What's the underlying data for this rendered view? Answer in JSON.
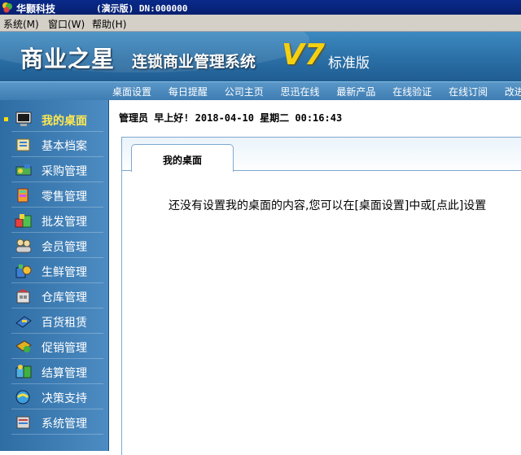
{
  "titlebar": {
    "company": "华颢科技",
    "info": "(演示版) DN:000000"
  },
  "menu": [
    "系统(M)",
    "窗口(W)",
    "帮助(H)"
  ],
  "banner": {
    "brand": "商业之星",
    "subtitle": "连锁商业管理系统",
    "version": "V7",
    "edition": "标准版"
  },
  "nav": [
    "桌面设置",
    "每日提醒",
    "公司主页",
    "思迅在线",
    "最新产品",
    "在线验证",
    "在线订阅",
    "改进建议"
  ],
  "sidebar": {
    "items": [
      {
        "label": "我的桌面",
        "icon": "monitor-icon",
        "active": true
      },
      {
        "label": "基本档案",
        "icon": "archive-icon"
      },
      {
        "label": "采购管理",
        "icon": "purchase-icon"
      },
      {
        "label": "零售管理",
        "icon": "retail-icon"
      },
      {
        "label": "批发管理",
        "icon": "wholesale-icon"
      },
      {
        "label": "会员管理",
        "icon": "members-icon"
      },
      {
        "label": "生鲜管理",
        "icon": "fresh-food-icon"
      },
      {
        "label": "仓库管理",
        "icon": "warehouse-icon"
      },
      {
        "label": "百货租赁",
        "icon": "lease-icon"
      },
      {
        "label": "促销管理",
        "icon": "promotion-icon"
      },
      {
        "label": "结算管理",
        "icon": "settlement-icon"
      },
      {
        "label": "决策支持",
        "icon": "decision-icon"
      },
      {
        "label": "系统管理",
        "icon": "system-icon"
      }
    ]
  },
  "greeting": "管理员 早上好! 2018-04-10 星期二 00:16:43",
  "tab": {
    "label": "我的桌面"
  },
  "message": "还没有设置我的桌面的内容,您可以在[桌面设置]中或[点此]设置",
  "colors": {
    "sidebar": "#3a7db6",
    "active_label": "#ffe850",
    "version": "#f4d010",
    "title_bar": "#0a2a8a"
  }
}
